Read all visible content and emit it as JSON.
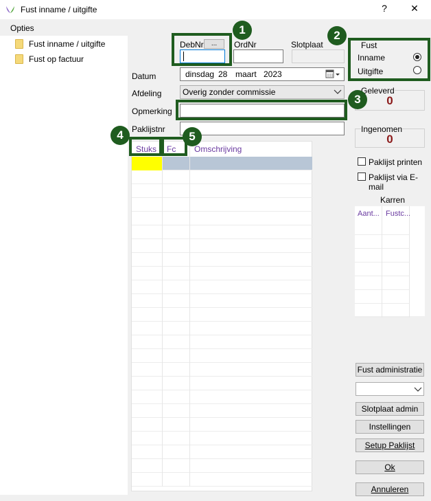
{
  "window": {
    "title": "Fust inname / uitgifte",
    "help_label": "?",
    "close_label": "✕"
  },
  "menu": {
    "opties": "Opties"
  },
  "sidebar": {
    "items": [
      {
        "label": "Fust inname / uitgifte"
      },
      {
        "label": "Fust op factuur"
      }
    ]
  },
  "form": {
    "debnr_label": "DebNr",
    "debnr_button": "...",
    "debnr_value": "",
    "ordnr_label": "OrdNr",
    "ordnr_value": "",
    "slotplaat_label": "Slotplaat",
    "datum_label": "Datum",
    "datum_day": "dinsdag",
    "datum_date": "28",
    "datum_month": "maart",
    "datum_year": "2023",
    "afdeling_label": "Afdeling",
    "afdeling_value": "Overig zonder commissie",
    "opmerking_label": "Opmerking",
    "opmerking_value": "",
    "paklijstnr_label": "Paklijstnr",
    "paklijstnr_value": ""
  },
  "grid": {
    "columns": [
      "Stuks",
      "Fc",
      "Omschrijving"
    ]
  },
  "fust": {
    "title": "Fust",
    "inname": "Inname",
    "uitgifte": "Uitgifte",
    "selected": "Inname"
  },
  "geleverd": {
    "label": "Geleverd",
    "value": "0"
  },
  "ingenomen": {
    "label": "Ingenomen",
    "value": "0"
  },
  "checks": {
    "paklijst_printen": "Paklijst printen",
    "paklijst_email": "Paklijst via E-mail"
  },
  "karren": {
    "title": "Karren",
    "col1": "Aant...",
    "col2": "Fustc..."
  },
  "buttons": {
    "fust_admin": "Fust administratie",
    "slotplaat_admin": "Slotplaat admin",
    "instellingen": "Instellingen",
    "setup_paklijst": "Setup Paklijst",
    "ok": "Ok",
    "annuleren": "Annuleren"
  },
  "callouts": [
    "1",
    "2",
    "3",
    "4",
    "5"
  ],
  "colors": {
    "callout": "#1f5c1f",
    "counter": "#8b1a1a",
    "header_text": "#6a3aa0",
    "row_highlight": "#b8c6d6",
    "cell_yellow": "#ffff00"
  }
}
